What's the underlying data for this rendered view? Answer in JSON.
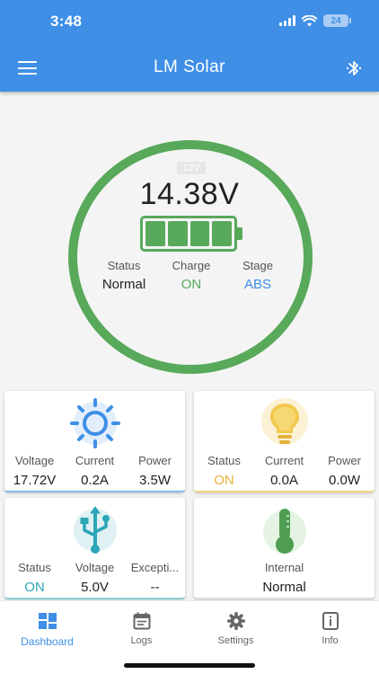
{
  "status_bar": {
    "time": "3:48",
    "battery": "24"
  },
  "app_bar": {
    "title": "LM Solar"
  },
  "battery_gauge": {
    "system_voltage": "12V",
    "voltage": "14.38V",
    "level_fraction": 1.0,
    "stats": [
      {
        "label": "Status",
        "value": "Normal"
      },
      {
        "label": "Charge",
        "value": "ON"
      },
      {
        "label": "Stage",
        "value": "ABS"
      }
    ]
  },
  "solar_card": {
    "stats": [
      {
        "label": "Voltage",
        "value": "17.72V"
      },
      {
        "label": "Current",
        "value": "0.2A"
      },
      {
        "label": "Power",
        "value": "3.5W"
      }
    ]
  },
  "load_card": {
    "stats": [
      {
        "label": "Status",
        "value": "ON"
      },
      {
        "label": "Current",
        "value": "0.0A"
      },
      {
        "label": "Power",
        "value": "0.0W"
      }
    ]
  },
  "usb_card": {
    "stats": [
      {
        "label": "Status",
        "value": "ON"
      },
      {
        "label": "Voltage",
        "value": "5.0V"
      },
      {
        "label": "Excepti...",
        "value": "--"
      }
    ]
  },
  "temp_card": {
    "stats": [
      {
        "label": "Internal",
        "value": "Normal"
      }
    ]
  },
  "bottom_nav": {
    "items": [
      {
        "label": "Dashboard",
        "icon": "dashboard-icon"
      },
      {
        "label": "Logs",
        "icon": "calendar-icon"
      },
      {
        "label": "Settings",
        "icon": "gear-icon"
      },
      {
        "label": "Info",
        "icon": "info-icon"
      }
    ],
    "active": "Dashboard"
  },
  "colors": {
    "primary": "#3f8fe6",
    "battery_green": "#58a95a",
    "load_yellow": "#e4b23a",
    "usb_teal": "#2aa6b6",
    "solar_blue": "#3f8fe6"
  }
}
